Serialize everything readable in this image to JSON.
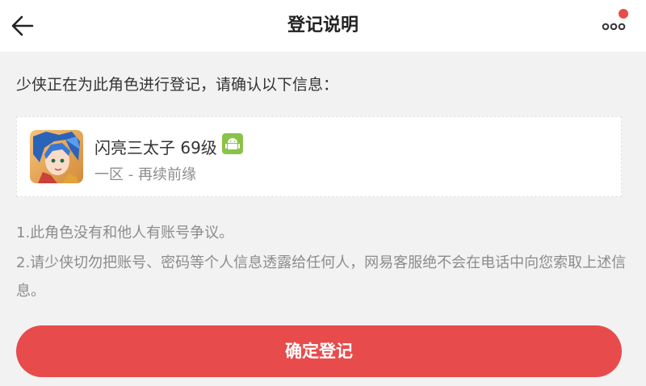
{
  "header": {
    "title": "登记说明",
    "back_icon": "arrow-left-icon",
    "more_icon": "more-dots-icon",
    "notification_dot_color": "#e84b4b"
  },
  "prompt": "少侠正在为此角色进行登记，请确认以下信息：",
  "role_card": {
    "name": "闪亮三太子 69级",
    "platform_icon": "android-icon",
    "platform_color": "#8bc34a",
    "server": "一区 - 再续前缘"
  },
  "notes": [
    "1.此角色没有和他人有账号争议。",
    "2.请少侠切勿把账号、密码等个人信息透露给任何人，网易客服绝不会在电话中向您索取上述信息。"
  ],
  "confirm_button": {
    "label": "确定登记",
    "color": "#e84b4b"
  }
}
